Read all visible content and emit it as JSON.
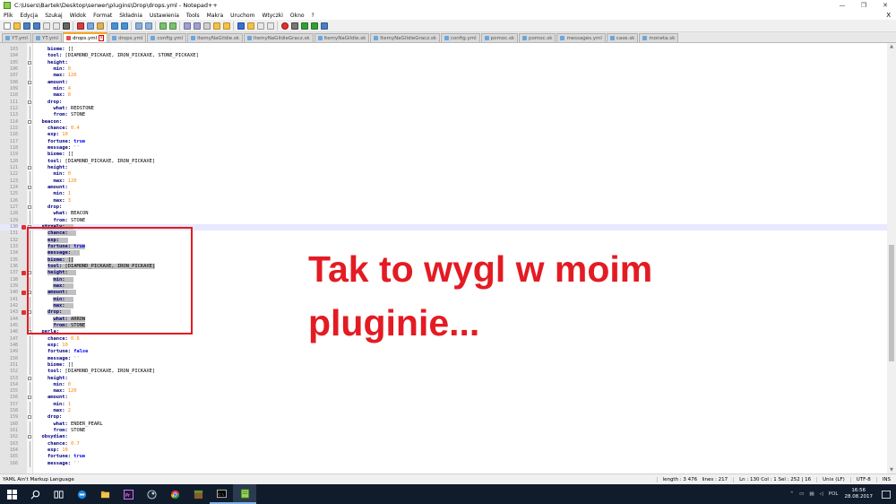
{
  "window": {
    "title": "C:\\Users\\Bartek\\Desktop\\serwer\\plugins\\Drop\\drops.yml - Notepad++",
    "controls": [
      "—",
      "❐",
      "✕"
    ]
  },
  "menu": [
    "Plik",
    "Edycja",
    "Szukaj",
    "Widok",
    "Format",
    "Składnia",
    "Ustawienia",
    "Tools",
    "Makra",
    "Uruchom",
    "Wtyczki",
    "Okno",
    "?"
  ],
  "menu_close": "X",
  "tabs": [
    {
      "label": "YT.yml",
      "active": false
    },
    {
      "label": "YT.yml",
      "active": false
    },
    {
      "label": "drops.yml",
      "active": true
    },
    {
      "label": "drops.yml",
      "active": false
    },
    {
      "label": "config.yml",
      "active": false
    },
    {
      "label": "ItemyNaGildie.sk",
      "active": false
    },
    {
      "label": "ItemyNaGildieGracz.sk",
      "active": false
    },
    {
      "label": "ItemyNaGildie.sk",
      "active": false
    },
    {
      "label": "ItemyNaGildieGracz.sk",
      "active": false
    },
    {
      "label": "config.yml",
      "active": false
    },
    {
      "label": "pomoc.sk",
      "active": false
    },
    {
      "label": "pomoc.sk",
      "active": false
    },
    {
      "label": "messages.yml",
      "active": false
    },
    {
      "label": "case.sk",
      "active": false
    },
    {
      "label": "moneta.sk",
      "active": false
    }
  ],
  "lines": [
    {
      "n": "103",
      "t": "    biome: []"
    },
    {
      "n": "104",
      "t": "    tool: [DIAMOND_PICKAXE, IRON_PICKAXE, STONE_PICKAXE]"
    },
    {
      "n": "105",
      "t": "    height:"
    },
    {
      "n": "106",
      "t": "      min: 0"
    },
    {
      "n": "107",
      "t": "      max: 120"
    },
    {
      "n": "108",
      "t": "    amount:"
    },
    {
      "n": "109",
      "t": "      min: 4"
    },
    {
      "n": "110",
      "t": "      max: 8"
    },
    {
      "n": "111",
      "t": "    drop:"
    },
    {
      "n": "112",
      "t": "      what: REDSTONE"
    },
    {
      "n": "113",
      "t": "      from: STONE"
    },
    {
      "n": "114",
      "t": "  beacon:"
    },
    {
      "n": "115",
      "t": "    chance: 0.4"
    },
    {
      "n": "116",
      "t": "    exp: 10"
    },
    {
      "n": "117",
      "t": "    fortune: true"
    },
    {
      "n": "118",
      "t": "    message: ''"
    },
    {
      "n": "119",
      "t": "    biome: []"
    },
    {
      "n": "120",
      "t": "    tool: [DIAMOND_PICKAXE, IRON_PICKAXE]"
    },
    {
      "n": "121",
      "t": "    height:"
    },
    {
      "n": "122",
      "t": "      min: 0"
    },
    {
      "n": "123",
      "t": "      max: 120"
    },
    {
      "n": "124",
      "t": "    amount:"
    },
    {
      "n": "125",
      "t": "      min: 1"
    },
    {
      "n": "126",
      "t": "      max: 3"
    },
    {
      "n": "127",
      "t": "    drop:"
    },
    {
      "n": "128",
      "t": "      what: BEACON"
    },
    {
      "n": "129",
      "t": "      from: STONE"
    },
    {
      "n": "130",
      "t": "  strzaly:"
    },
    {
      "n": "131",
      "t": "    chance:"
    },
    {
      "n": "132",
      "t": "    exp:"
    },
    {
      "n": "133",
      "t": "    fortune: true"
    },
    {
      "n": "134",
      "t": "    message: ''"
    },
    {
      "n": "135",
      "t": "    biome: []"
    },
    {
      "n": "136",
      "t": "    tool: [DIAMOND_PICKAXE, IRON_PICKAXE]"
    },
    {
      "n": "137",
      "t": "    height:"
    },
    {
      "n": "138",
      "t": "      min:"
    },
    {
      "n": "139",
      "t": "      max:"
    },
    {
      "n": "140",
      "t": "    amount:"
    },
    {
      "n": "141",
      "t": "      min:"
    },
    {
      "n": "142",
      "t": "      max:"
    },
    {
      "n": "143",
      "t": "    drop:"
    },
    {
      "n": "144",
      "t": "      what: ARROW"
    },
    {
      "n": "145",
      "t": "      from: STONE"
    },
    {
      "n": "146",
      "t": "  perla:"
    },
    {
      "n": "147",
      "t": "    chance: 0.6"
    },
    {
      "n": "148",
      "t": "    exp: 10"
    },
    {
      "n": "149",
      "t": "    fortune: false"
    },
    {
      "n": "150",
      "t": "    message: ''"
    },
    {
      "n": "151",
      "t": "    biome: []"
    },
    {
      "n": "152",
      "t": "    tool: [DIAMOND_PICKAXE, IRON_PICKAXE]"
    },
    {
      "n": "153",
      "t": "    height:"
    },
    {
      "n": "154",
      "t": "      min: 0"
    },
    {
      "n": "155",
      "t": "      max: 120"
    },
    {
      "n": "156",
      "t": "    amount:"
    },
    {
      "n": "157",
      "t": "      min: 1"
    },
    {
      "n": "158",
      "t": "      max: 2"
    },
    {
      "n": "159",
      "t": "    drop:"
    },
    {
      "n": "160",
      "t": "      what: ENDER_PEARL"
    },
    {
      "n": "161",
      "t": "      from: STONE"
    },
    {
      "n": "162",
      "t": "  obsydian:"
    },
    {
      "n": "163",
      "t": "    chance: 0.7"
    },
    {
      "n": "164",
      "t": "    exp: 10"
    },
    {
      "n": "165",
      "t": "    fortune: true"
    },
    {
      "n": "166",
      "t": "    message: ''"
    }
  ],
  "annotation": {
    "line1": "Tak to wygl w moim",
    "line2": "pluginie..."
  },
  "status": {
    "language": "YAML Ain't Markup Language",
    "length": "length : 3 476",
    "lines": "lines : 217",
    "position": "Ln : 130   Col : 1   Sel : 252 | 16",
    "eol": "Unix (LF)",
    "encoding": "UTF-8",
    "mode": "INS"
  },
  "taskbar": {
    "tray_lang": "POL",
    "time": "16:56",
    "date": "28.08.2017"
  },
  "colors": {
    "annotation_red": "#e31b23",
    "tab_active_accent": "#f5a623",
    "yaml_key": "#000080",
    "yaml_number": "#ff8000",
    "yaml_keyword": "#0000ff",
    "taskbar_bg": "#101c2c"
  }
}
